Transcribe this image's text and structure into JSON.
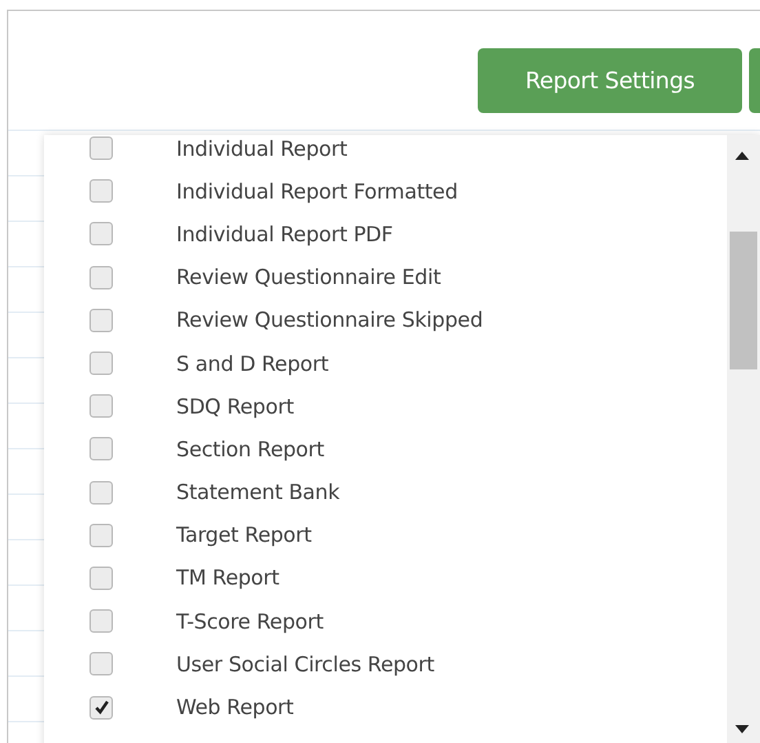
{
  "toolbar": {
    "button": "Report Settings"
  },
  "report_list": {
    "items": [
      {
        "label": "Individual Report",
        "checked": false
      },
      {
        "label": "Individual Report Formatted",
        "checked": false
      },
      {
        "label": "Individual Report PDF",
        "checked": false
      },
      {
        "label": "Review Questionnaire Edit",
        "checked": false
      },
      {
        "label": "Review Questionnaire Skipped",
        "checked": false
      },
      {
        "label": "S and D Report",
        "checked": false
      },
      {
        "label": "SDQ Report",
        "checked": false
      },
      {
        "label": "Section Report",
        "checked": false
      },
      {
        "label": "Statement Bank",
        "checked": false
      },
      {
        "label": "Target Report",
        "checked": false
      },
      {
        "label": "TM Report",
        "checked": false
      },
      {
        "label": "T-Score Report",
        "checked": false
      },
      {
        "label": "User Social Circles Report",
        "checked": false
      },
      {
        "label": "Web Report",
        "checked": true
      }
    ]
  }
}
